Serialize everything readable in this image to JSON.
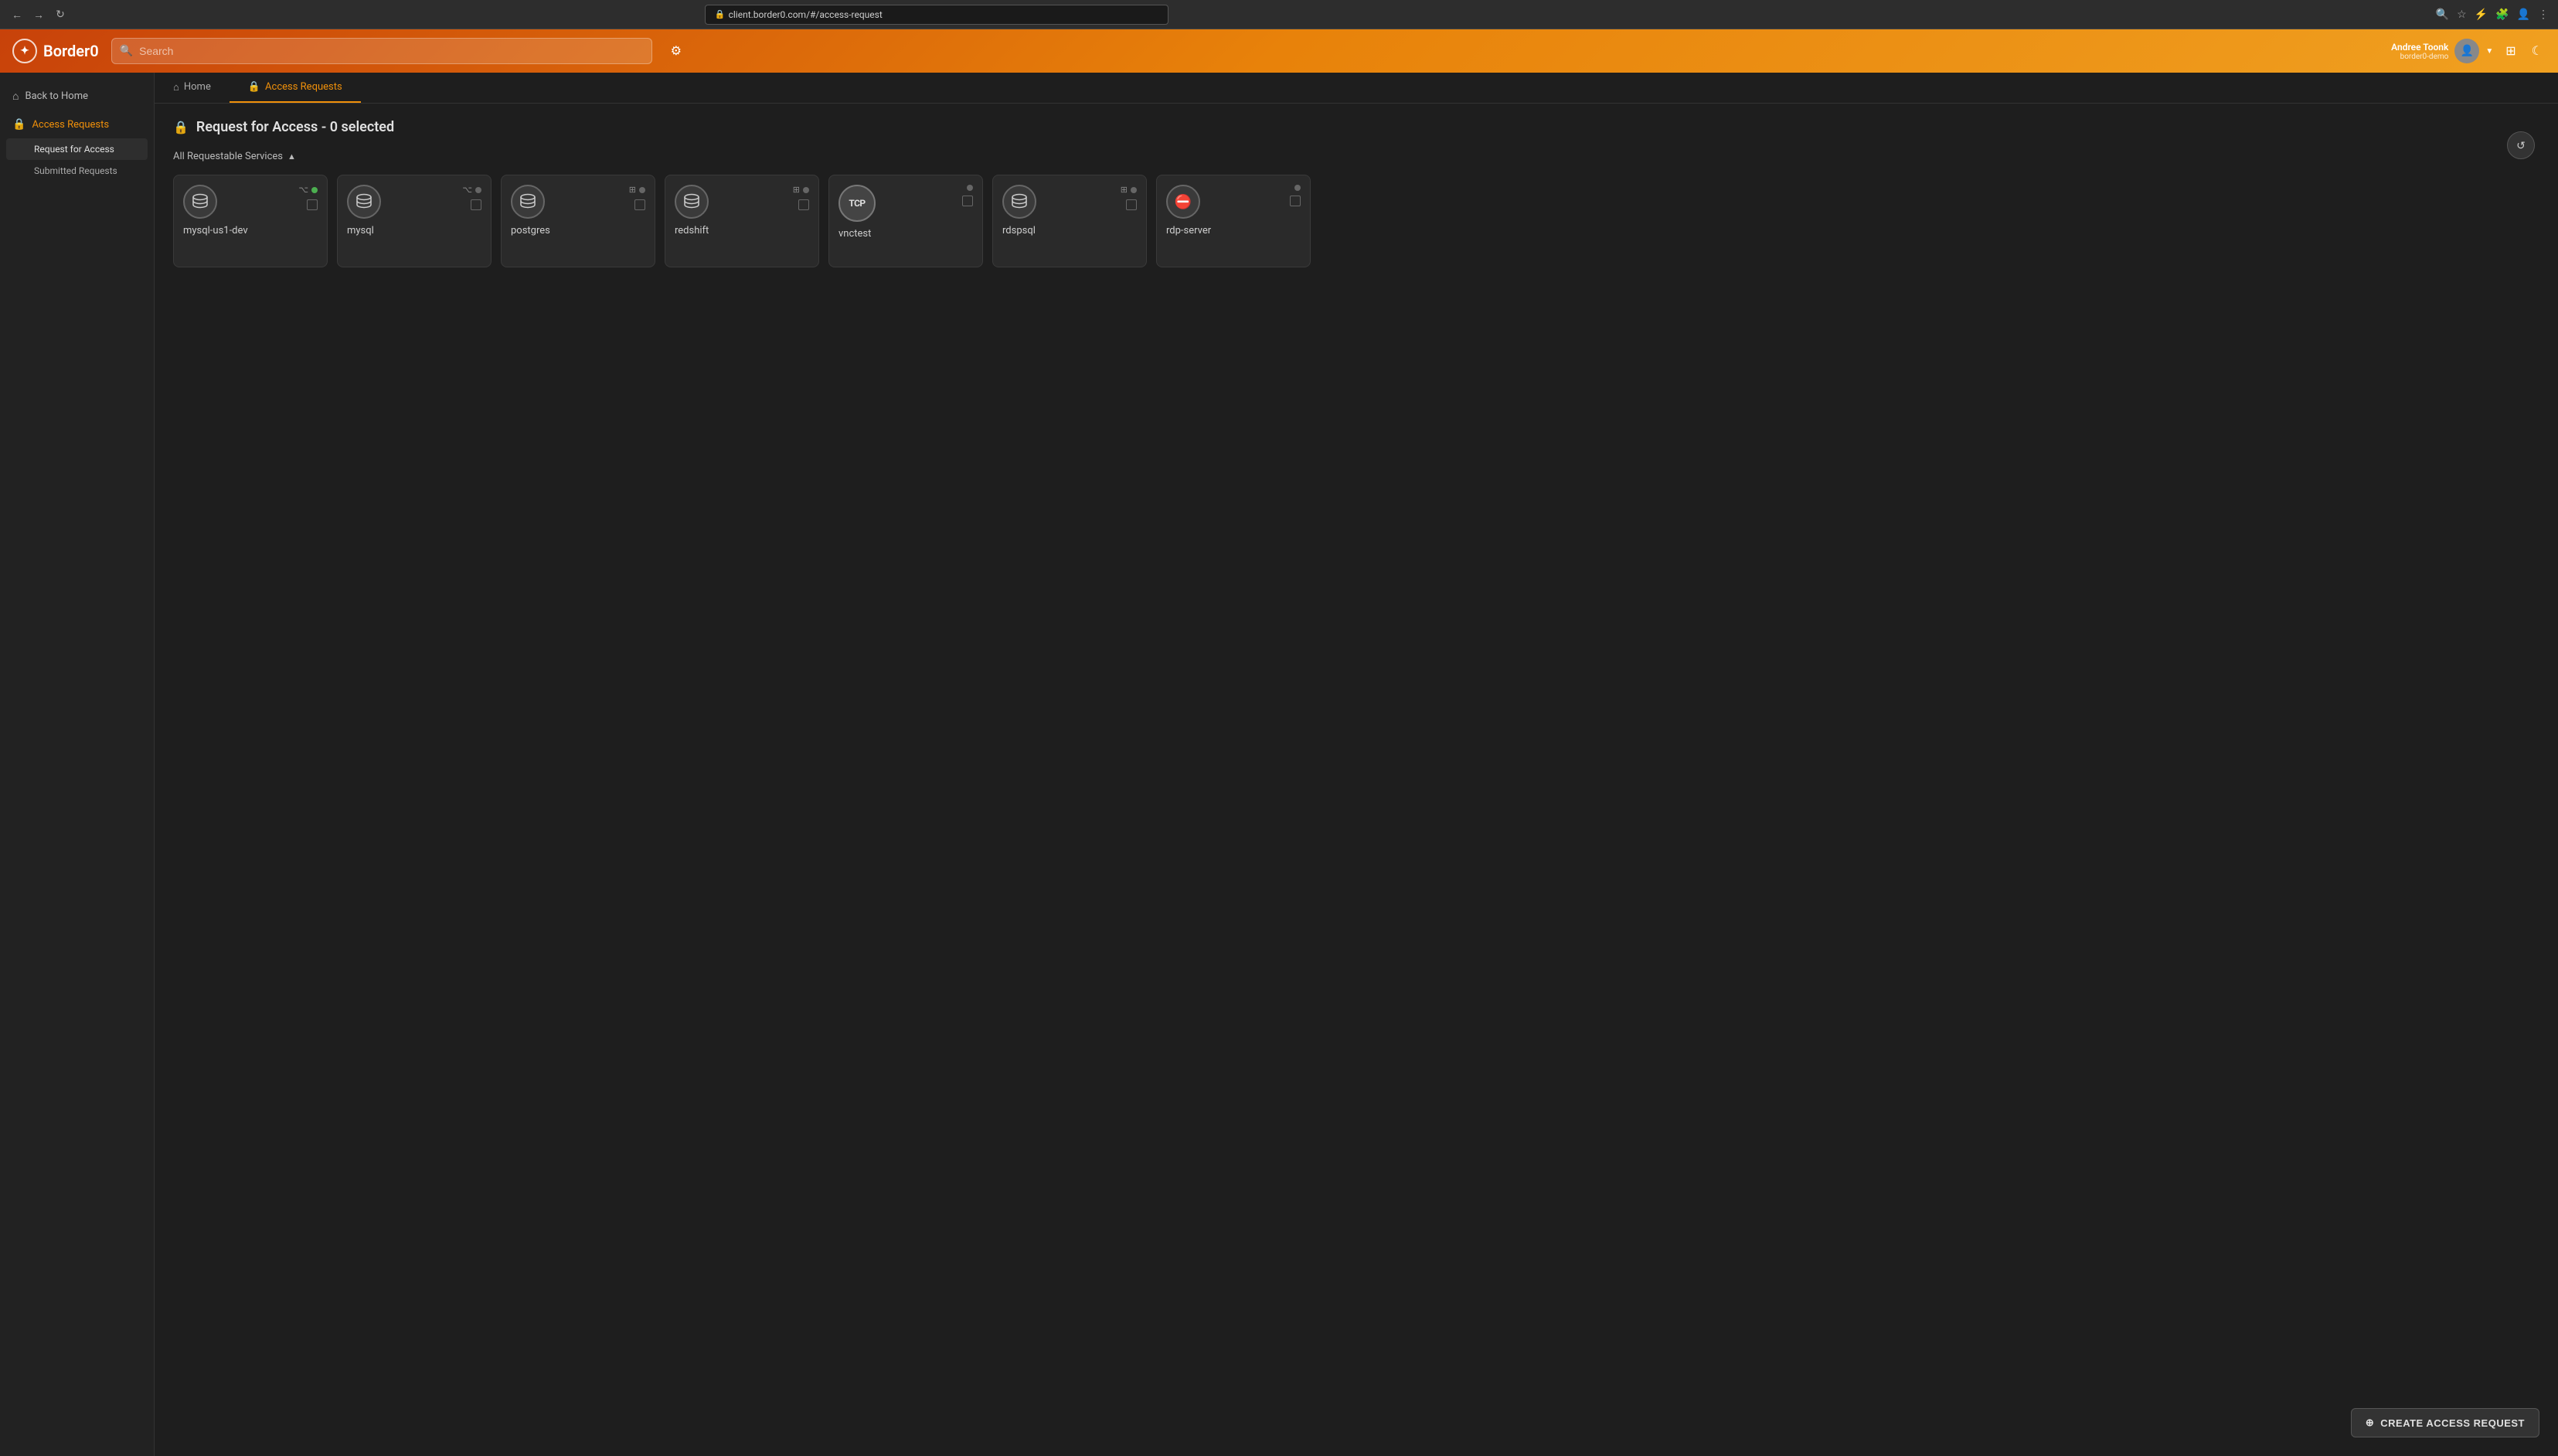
{
  "browser": {
    "url": "client.border0.com/#/access-request",
    "nav_back": "←",
    "nav_forward": "→",
    "nav_reload": "↻"
  },
  "header": {
    "logo_text": "Border0",
    "logo_icon": "✦",
    "search_placeholder": "Search",
    "filter_icon": "⚙",
    "user_name": "Andree Toonk",
    "user_org": "border0-demo",
    "grid_icon": "⊞",
    "theme_icon": "☾"
  },
  "nav": {
    "tabs": [
      {
        "id": "home",
        "label": "Home",
        "icon": "⌂",
        "active": false
      },
      {
        "id": "access-requests",
        "label": "Access Requests",
        "icon": "🔒",
        "active": true
      }
    ]
  },
  "sidebar": {
    "items": [
      {
        "id": "back-to-home",
        "label": "Back to Home",
        "icon": "⌂",
        "active": false
      },
      {
        "id": "access-requests",
        "label": "Access Requests",
        "icon": "🔒",
        "active": true
      }
    ],
    "sub_items": [
      {
        "id": "request-for-access",
        "label": "Request for Access",
        "active": true
      },
      {
        "id": "submitted-requests",
        "label": "Submitted Requests",
        "active": false
      }
    ]
  },
  "page": {
    "title": "Request for Access - 0 selected",
    "section_header": "All Requestable Services"
  },
  "services": [
    {
      "id": "mysql-us1-dev",
      "name": "mysql-us1-dev",
      "type": "database",
      "status": "green",
      "has_connector": true
    },
    {
      "id": "mysql",
      "name": "mysql",
      "type": "database",
      "status": "gray",
      "has_connector": true
    },
    {
      "id": "postgres",
      "name": "postgres",
      "type": "database",
      "status": "gray",
      "has_connector": true
    },
    {
      "id": "redshift",
      "name": "redshift",
      "type": "database",
      "status": "gray",
      "has_connector": true
    },
    {
      "id": "vnctest",
      "name": "vnctest",
      "type": "tcp",
      "status": "gray",
      "has_connector": false
    },
    {
      "id": "rdspsql",
      "name": "rdspsql",
      "type": "database",
      "status": "gray",
      "has_connector": true
    },
    {
      "id": "rdp-server",
      "name": "rdp-server",
      "type": "rdp",
      "status": "gray",
      "has_connector": false
    }
  ],
  "buttons": {
    "create_access_request": "CREATE ACCESS REQUEST",
    "refresh": "↺"
  }
}
